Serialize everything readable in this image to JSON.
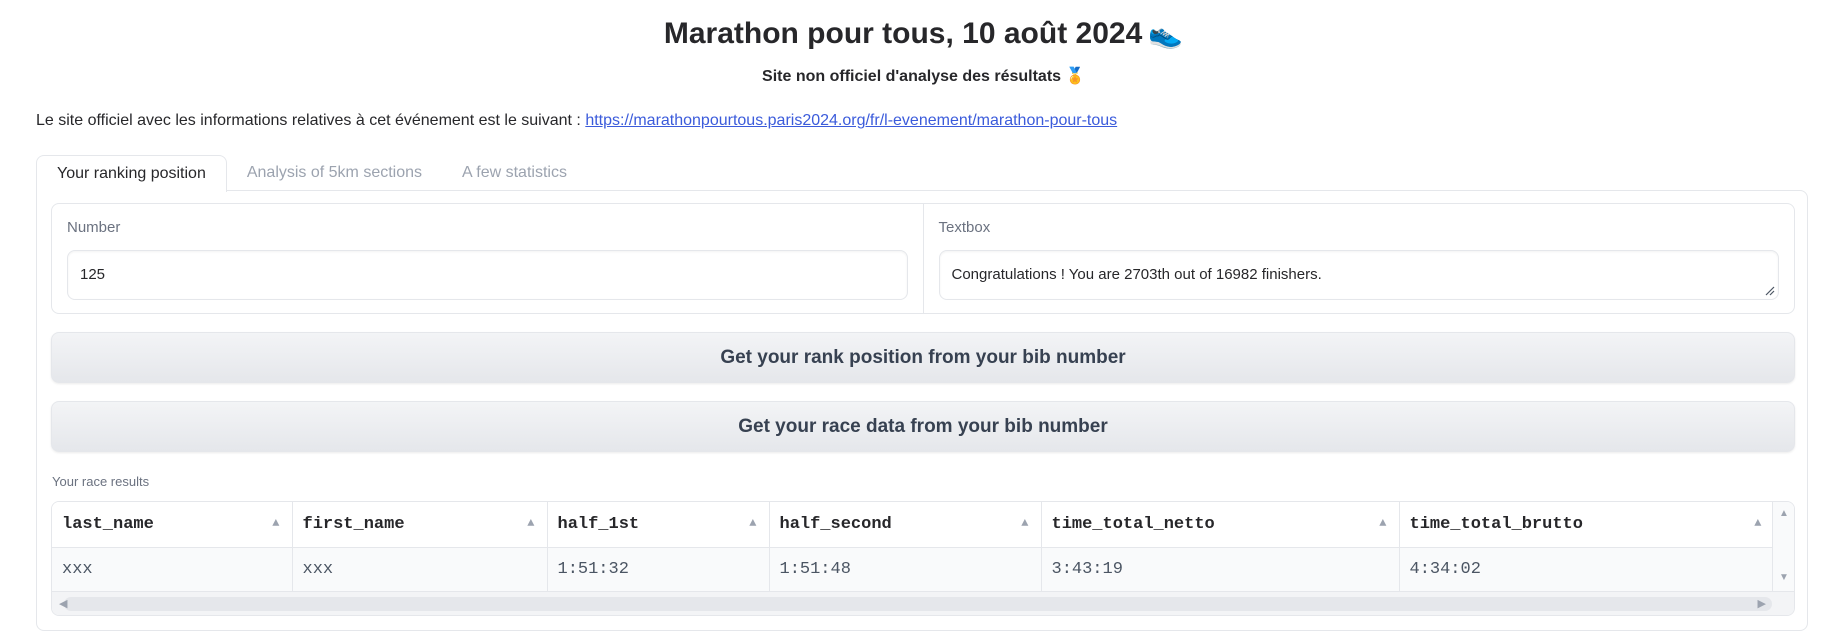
{
  "header": {
    "title": "Marathon pour tous, 10 août 2024",
    "title_emoji": "👟",
    "subtitle": "Site non officiel d'analyse des résultats",
    "subtitle_emoji": "🏅"
  },
  "official": {
    "text": "Le site officiel avec les informations relatives à cet événement est le suivant : ",
    "link": "https://marathonpourtous.paris2024.org/fr/l-evenement/marathon-pour-tous"
  },
  "tabs": [
    {
      "label": "Your ranking position",
      "active": true
    },
    {
      "label": "Analysis of 5km sections",
      "active": false
    },
    {
      "label": "A few statistics",
      "active": false
    }
  ],
  "fields": {
    "number": {
      "label": "Number",
      "value": "125"
    },
    "textbox": {
      "label": "Textbox",
      "value": "Congratulations ! You are 2703th out of 16982 finishers."
    }
  },
  "buttons": {
    "rank": "Get your rank position from your bib number",
    "race": "Get your race data from your bib number"
  },
  "results": {
    "label": "Your race results",
    "columns": [
      "last_name",
      "first_name",
      "half_1st",
      "half_second",
      "time_total_netto",
      "time_total_brutto"
    ],
    "rows": [
      [
        "xxx",
        "xxx",
        "1:51:32",
        "1:51:48",
        "3:43:19",
        "4:34:02"
      ]
    ]
  }
}
